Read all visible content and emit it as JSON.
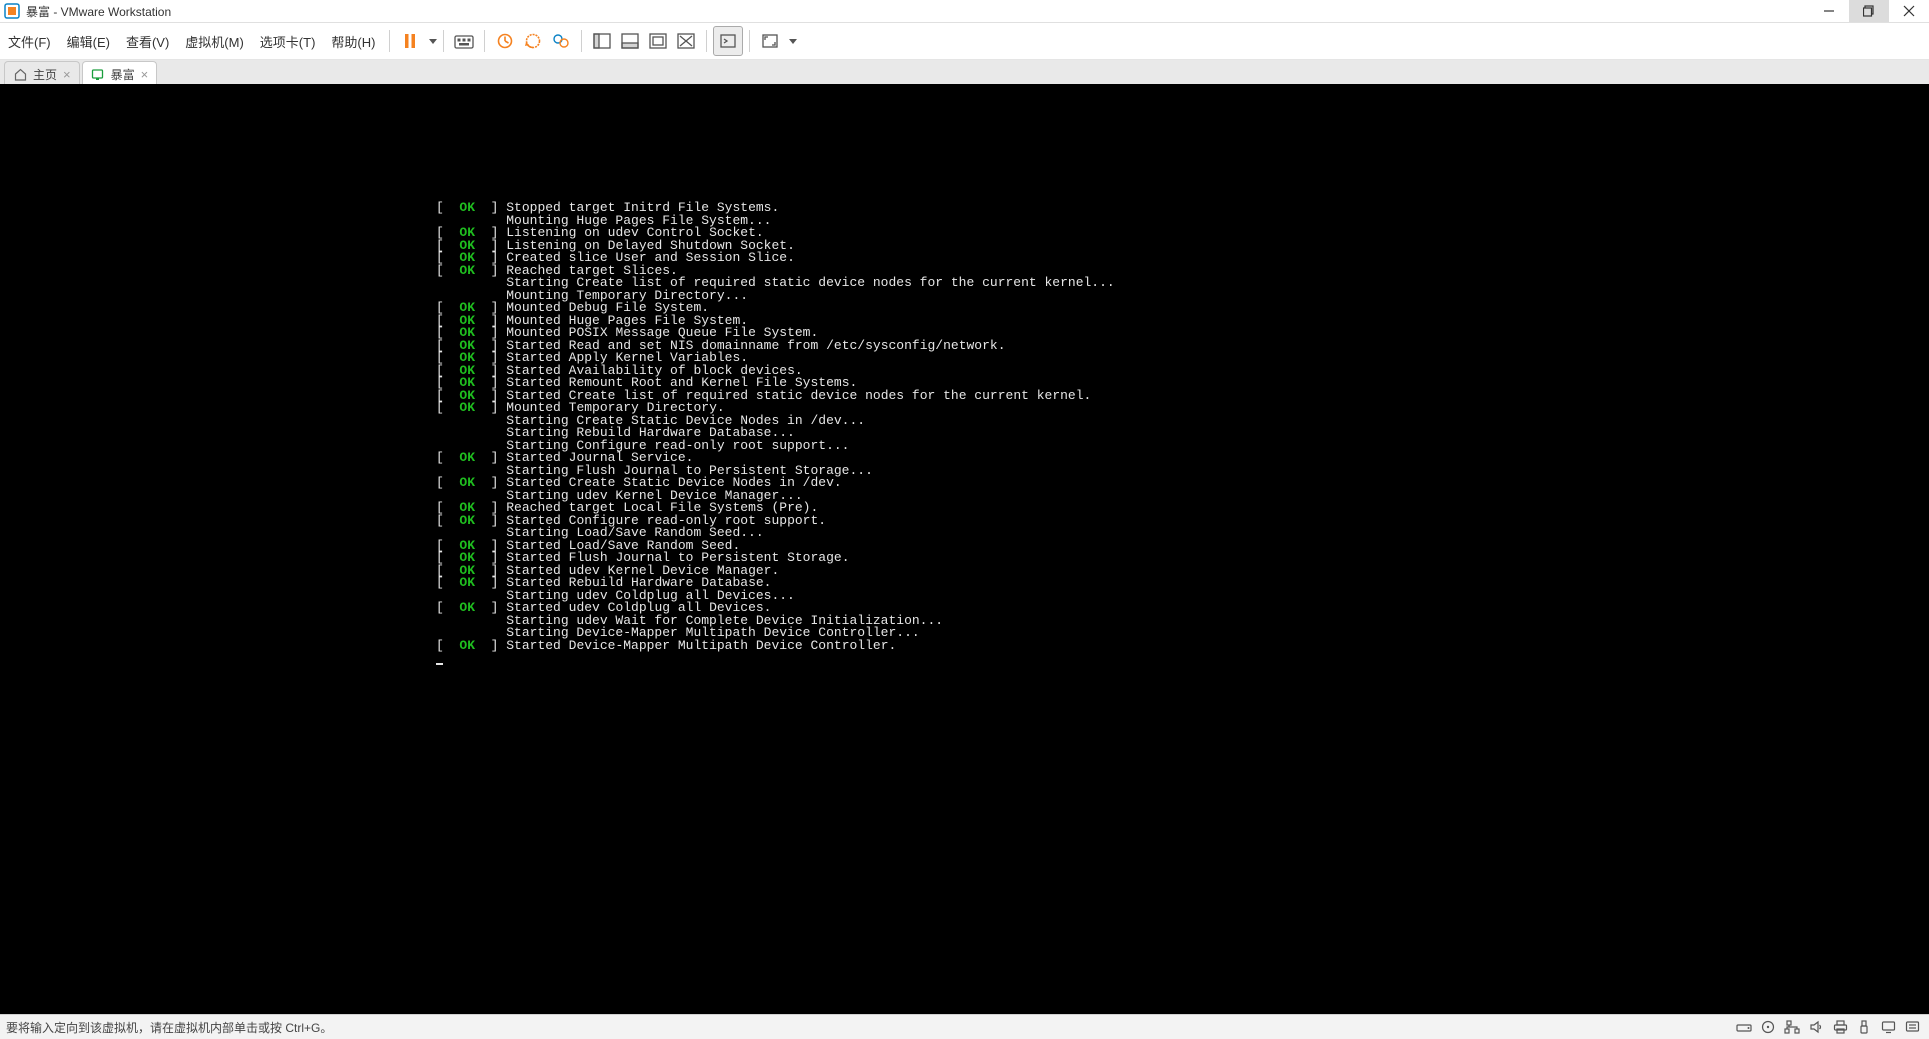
{
  "window": {
    "title": "暴富 - VMware Workstation"
  },
  "menu": {
    "file": "文件(F)",
    "edit": "编辑(E)",
    "view": "查看(V)",
    "vm": "虚拟机(M)",
    "tabs": "选项卡(T)",
    "help": "帮助(H)"
  },
  "tabs": {
    "home": {
      "label": "主页"
    },
    "guest": {
      "label": "暴富"
    }
  },
  "status": {
    "text": "要将输入定向到该虚拟机，请在虚拟机内部单击或按 Ctrl+G。"
  },
  "colors": {
    "ok_green": "#1fbd1f",
    "vmware_orange": "#f58220",
    "console_bg": "#000000",
    "console_fg": "#e6e6e6"
  },
  "boot_log": [
    {
      "status": "OK",
      "prefix": "Stopped target ",
      "msg": "Initrd File Systems."
    },
    {
      "status": "",
      "prefix": "",
      "msg": "Mounting Huge Pages File System..."
    },
    {
      "status": "OK",
      "prefix": "Listening on ",
      "msg": "udev Control Socket."
    },
    {
      "status": "OK",
      "prefix": "Listening on ",
      "msg": "Delayed Shutdown Socket."
    },
    {
      "status": "OK",
      "prefix": "Created slice ",
      "msg": "User and Session Slice."
    },
    {
      "status": "OK",
      "prefix": "Reached target ",
      "msg": "Slices."
    },
    {
      "status": "",
      "prefix": "",
      "msg": "Starting Create list of required static device nodes for the current kernel..."
    },
    {
      "status": "",
      "prefix": "",
      "msg": "Mounting Temporary Directory..."
    },
    {
      "status": "OK",
      "prefix": "Mounted ",
      "msg": "Debug File System."
    },
    {
      "status": "OK",
      "prefix": "Mounted ",
      "msg": "Huge Pages File System."
    },
    {
      "status": "OK",
      "prefix": "Mounted ",
      "msg": "POSIX Message Queue File System."
    },
    {
      "status": "OK",
      "prefix": "Started ",
      "msg": "Read and set NIS domainname from /etc/sysconfig/network."
    },
    {
      "status": "OK",
      "prefix": "Started ",
      "msg": "Apply Kernel Variables."
    },
    {
      "status": "OK",
      "prefix": "Started ",
      "msg": "Availability of block devices."
    },
    {
      "status": "OK",
      "prefix": "Started ",
      "msg": "Remount Root and Kernel File Systems."
    },
    {
      "status": "OK",
      "prefix": "Started ",
      "msg": "Create list of required static device nodes for the current kernel."
    },
    {
      "status": "OK",
      "prefix": "Mounted ",
      "msg": "Temporary Directory."
    },
    {
      "status": "",
      "prefix": "",
      "msg": "Starting Create Static Device Nodes in /dev..."
    },
    {
      "status": "",
      "prefix": "",
      "msg": "Starting Rebuild Hardware Database..."
    },
    {
      "status": "",
      "prefix": "",
      "msg": "Starting Configure read-only root support..."
    },
    {
      "status": "OK",
      "prefix": "Started ",
      "msg": "Journal Service."
    },
    {
      "status": "",
      "prefix": "",
      "msg": "Starting Flush Journal to Persistent Storage..."
    },
    {
      "status": "OK",
      "prefix": "Started ",
      "msg": "Create Static Device Nodes in /dev."
    },
    {
      "status": "",
      "prefix": "",
      "msg": "Starting udev Kernel Device Manager..."
    },
    {
      "status": "OK",
      "prefix": "Reached target ",
      "msg": "Local File Systems (Pre)."
    },
    {
      "status": "OK",
      "prefix": "Started ",
      "msg": "Configure read-only root support."
    },
    {
      "status": "",
      "prefix": "",
      "msg": "Starting Load/Save Random Seed..."
    },
    {
      "status": "OK",
      "prefix": "Started ",
      "msg": "Load/Save Random Seed."
    },
    {
      "status": "OK",
      "prefix": "Started ",
      "msg": "Flush Journal to Persistent Storage."
    },
    {
      "status": "OK",
      "prefix": "Started ",
      "msg": "udev Kernel Device Manager."
    },
    {
      "status": "OK",
      "prefix": "Started ",
      "msg": "Rebuild Hardware Database."
    },
    {
      "status": "",
      "prefix": "",
      "msg": "Starting udev Coldplug all Devices..."
    },
    {
      "status": "OK",
      "prefix": "Started ",
      "msg": "udev Coldplug all Devices."
    },
    {
      "status": "",
      "prefix": "",
      "msg": "Starting udev Wait for Complete Device Initialization..."
    },
    {
      "status": "",
      "prefix": "",
      "msg": "Starting Device-Mapper Multipath Device Controller..."
    },
    {
      "status": "OK",
      "prefix": "Started ",
      "msg": "Device-Mapper Multipath Device Controller."
    }
  ]
}
